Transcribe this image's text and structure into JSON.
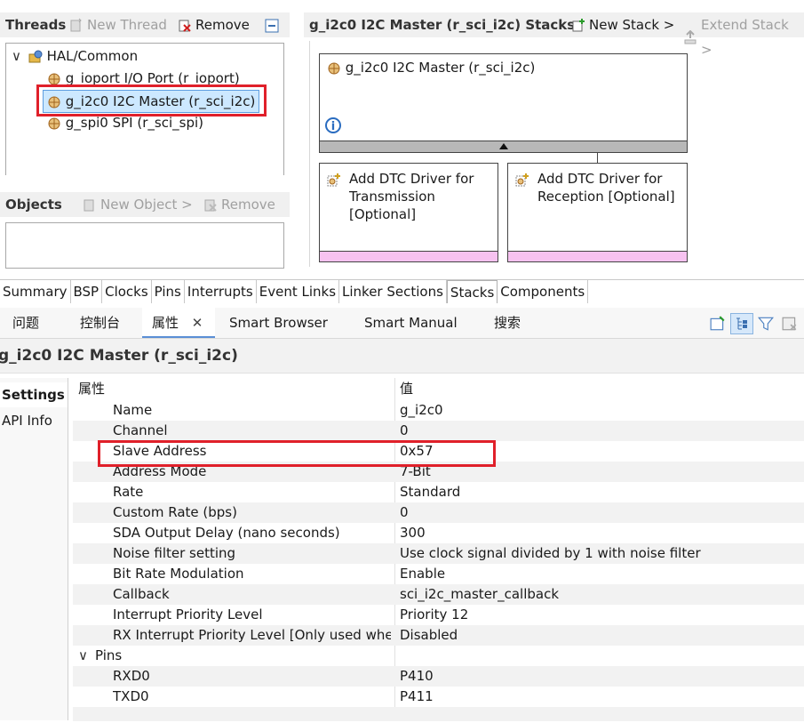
{
  "threads": {
    "title": "Threads",
    "new_thread": "New Thread",
    "remove": "Remove",
    "tree": {
      "group": "HAL/Common",
      "items": [
        {
          "label": "g_ioport I/O Port (r_ioport)"
        },
        {
          "label": "g_i2c0 I2C Master (r_sci_i2c)"
        },
        {
          "label": "g_spi0 SPI (r_sci_spi)"
        }
      ]
    }
  },
  "objects": {
    "title": "Objects",
    "new_object": "New Object >",
    "remove": "Remove"
  },
  "stacks": {
    "title": "g_i2c0 I2C Master (r_sci_i2c) Stacks",
    "new_stack": "New Stack >",
    "extend_stack": "Extend Stack >",
    "main_module": "g_i2c0 I2C Master (r_sci_i2c)",
    "sub_modules": [
      {
        "label": "Add DTC Driver for Transmission [Optional]"
      },
      {
        "label": "Add DTC Driver for Reception [Optional]"
      }
    ]
  },
  "config_tabs": [
    "Summary",
    "BSP",
    "Clocks",
    "Pins",
    "Interrupts",
    "Event Links",
    "Linker Sections",
    "Stacks",
    "Components"
  ],
  "config_active_tab": "Stacks",
  "view_tabs": [
    "问题",
    "控制台",
    "属性",
    "Smart Browser",
    "Smart Manual",
    "搜索"
  ],
  "view_active_tab": "属性",
  "properties": {
    "title": "g_i2c0 I2C Master (r_sci_i2c)",
    "side_tabs": [
      "Settings",
      "API Info"
    ],
    "col_property": "属性",
    "col_value": "值",
    "rows": [
      {
        "name": "Name",
        "value": "g_i2c0"
      },
      {
        "name": "Channel",
        "value": "0"
      },
      {
        "name": "Slave Address",
        "value": "0x57"
      },
      {
        "name": "Address Mode",
        "value": "7-Bit"
      },
      {
        "name": "Rate",
        "value": "Standard"
      },
      {
        "name": "Custom Rate (bps)",
        "value": "0"
      },
      {
        "name": "SDA Output Delay (nano seconds)",
        "value": "300"
      },
      {
        "name": "Noise filter setting",
        "value": "Use clock signal divided by 1 with noise filter"
      },
      {
        "name": "Bit Rate Modulation",
        "value": "Enable"
      },
      {
        "name": "Callback",
        "value": "sci_i2c_master_callback"
      },
      {
        "name": "Interrupt Priority Level",
        "value": "Priority 12"
      },
      {
        "name": "RX Interrupt Priority Level [Only used when",
        "value": "Disabled"
      }
    ],
    "pins_group": "Pins",
    "pin_rows": [
      {
        "name": "RXD0",
        "value": "P410"
      },
      {
        "name": "TXD0",
        "value": "P411"
      }
    ]
  },
  "colors": {
    "highlight_border": "#e0202a",
    "selection_bg": "#cce8ff",
    "stack_strip": "#f7c2f0"
  }
}
